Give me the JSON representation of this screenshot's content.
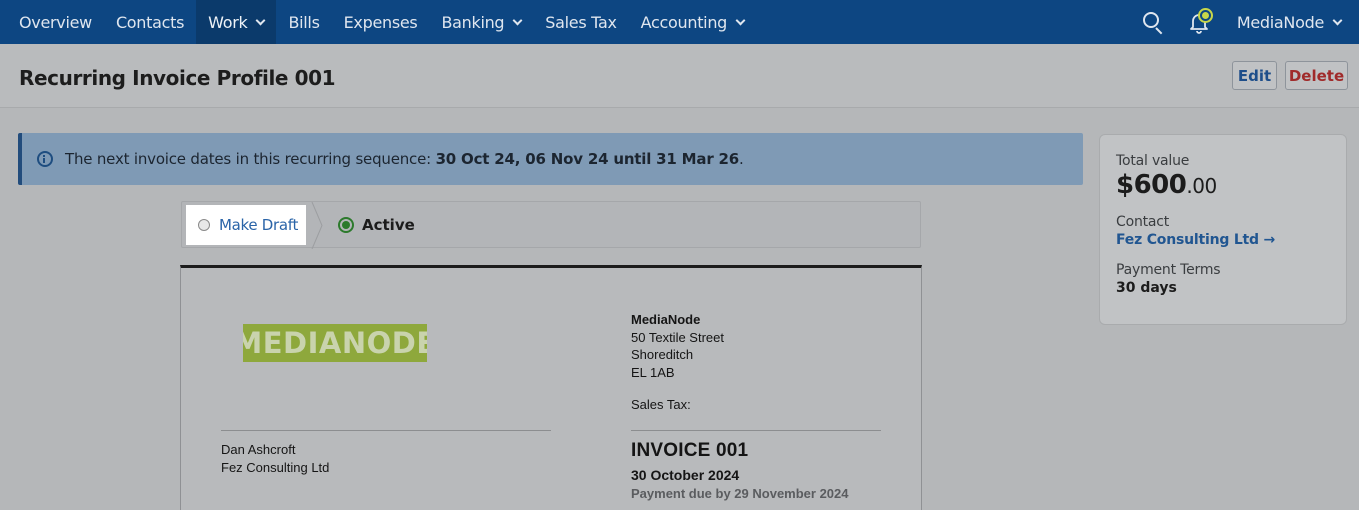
{
  "nav": {
    "items": [
      {
        "label": "Overview",
        "has_dropdown": false,
        "active": false
      },
      {
        "label": "Contacts",
        "has_dropdown": false,
        "active": false
      },
      {
        "label": "Work",
        "has_dropdown": true,
        "active": true
      },
      {
        "label": "Bills",
        "has_dropdown": false,
        "active": false
      },
      {
        "label": "Expenses",
        "has_dropdown": false,
        "active": false
      },
      {
        "label": "Banking",
        "has_dropdown": true,
        "active": false
      },
      {
        "label": "Sales Tax",
        "has_dropdown": false,
        "active": false
      },
      {
        "label": "Accounting",
        "has_dropdown": true,
        "active": false
      }
    ],
    "org_name": "MediaNode",
    "icons": [
      "search-icon",
      "bell-icon",
      "chevron-down-icon"
    ],
    "accent_color": "#0d4682"
  },
  "header": {
    "title": "Recurring Invoice Profile 001",
    "edit_label": "Edit",
    "delete_label": "Delete"
  },
  "alert": {
    "prefix": "The next invoice dates in this recurring sequence: ",
    "dates": "30 Oct 24, 06 Nov 24 until 31 Mar 26",
    "suffix": "."
  },
  "status": {
    "make_draft_label": "Make Draft",
    "active_label": "Active",
    "current": "Active"
  },
  "invoice": {
    "logo_text": "MEDIANODE",
    "company_name": "MediaNode",
    "address_lines": [
      "50 Textile Street",
      "Shoreditch",
      "EL 1AB"
    ],
    "sales_tax_label": "Sales Tax:",
    "bill_to": [
      "Dan Ashcroft",
      "Fez Consulting Ltd"
    ],
    "title": "INVOICE 001",
    "date": "30 October 2024",
    "due": "Payment due by 29 November 2024"
  },
  "summary": {
    "total_label": "Total value",
    "total_main": "$600",
    "total_cents": ".00",
    "contact_label": "Contact",
    "contact_name": "Fez Consulting Ltd →",
    "terms_label": "Payment Terms",
    "terms_value": "30 days"
  }
}
